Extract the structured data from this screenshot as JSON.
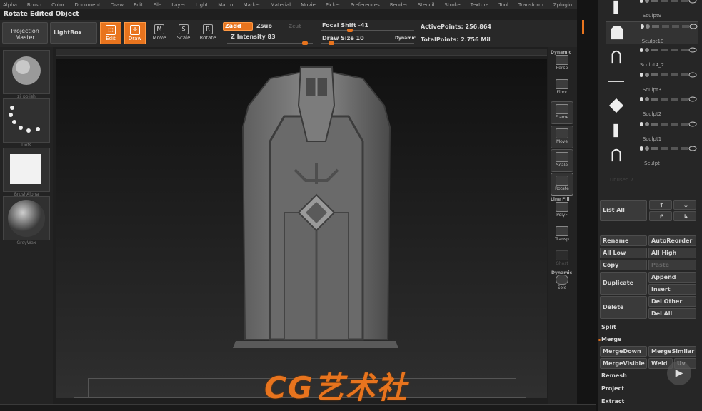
{
  "menubar": {
    "items": [
      "Alpha",
      "Brush",
      "Color",
      "Document",
      "Draw",
      "Edit",
      "File",
      "Layer",
      "Light",
      "Macro",
      "Marker",
      "Material",
      "Movie",
      "Picker",
      "Preferences",
      "Render",
      "Stencil",
      "Stroke",
      "Texture",
      "Tool",
      "Transform",
      "Zplugin",
      "Zscript"
    ]
  },
  "status": {
    "title": "Rotate Edited Object"
  },
  "toolbar": {
    "projection_master": "Projection Master",
    "lightbox": "LightBox",
    "edit": "Edit",
    "draw": "Draw",
    "move": "Move",
    "scale": "Scale",
    "rotate": "Rotate",
    "zadd": "Zadd",
    "zsub": "Zsub",
    "zcut": "Zcut",
    "z_intensity": "Z Intensity 83",
    "focal_shift": "Focal Shift -41",
    "draw_size": "Draw Size 10",
    "dynamic": "Dynamic",
    "active_points": "ActivePoints: 256,864",
    "total_points": "TotalPoints: 2.756 Mil",
    "z_intensity_value": 83,
    "focal_shift_value": -41,
    "draw_size_value": 10
  },
  "left_shelf": [
    {
      "label": "zi_polish",
      "icon": "brush-sphere-icon"
    },
    {
      "label": "Dots",
      "icon": "stroke-dots-icon"
    },
    {
      "label": "BrushAlpha",
      "icon": "alpha-white-icon"
    },
    {
      "label": "GreyWax",
      "icon": "material-sphere-icon"
    }
  ],
  "right_shelf": {
    "dynamic": "Dynamic",
    "persp": "Persp",
    "floor": "Floor",
    "frame": "Frame",
    "move": "Move",
    "scale": "Scale",
    "rotate": "Rotate",
    "line_fill": "Line Fill",
    "polyf": "PolyF",
    "transp": "Transp",
    "ghost": "Ghost",
    "dynamic2": "Dynamic",
    "solo": "Solo"
  },
  "subtools": [
    {
      "name": "Sculpt9",
      "icon": "tall-slab-icon"
    },
    {
      "name": "Sculpt10",
      "icon": "tombstone-icon"
    },
    {
      "name": "Sculpt4_2",
      "icon": "arch-icon"
    },
    {
      "name": "Sculpt3",
      "icon": "line-icon"
    },
    {
      "name": "Sculpt2",
      "icon": "diamond-icon"
    },
    {
      "name": "Sculpt1",
      "icon": "tall-slab-icon"
    },
    {
      "name": "Sculpt",
      "icon": "arch-icon"
    }
  ],
  "subtool_panel": {
    "unused": "Unused 7",
    "list_all": "List All",
    "rename": "Rename",
    "auto_reorder": "AutoReorder",
    "all_low": "All Low",
    "all_high": "All High",
    "copy": "Copy",
    "paste": "Paste",
    "duplicate": "Duplicate",
    "append": "Append",
    "insert": "Insert",
    "delete": "Delete",
    "del_other": "Del Other",
    "del_all": "Del All",
    "split": "Split",
    "merge": "Merge",
    "merge_down": "MergeDown",
    "merge_similar": "MergeSimilar",
    "merge_visible": "MergeVisible",
    "weld": "Weld",
    "uv": "Uv",
    "remesh": "Remesh",
    "project": "Project",
    "extract": "Extract"
  },
  "watermark": "CG艺术社",
  "colors": {
    "accent": "#e8741e",
    "panel": "#262626",
    "viewport": "#1a1a1a"
  }
}
